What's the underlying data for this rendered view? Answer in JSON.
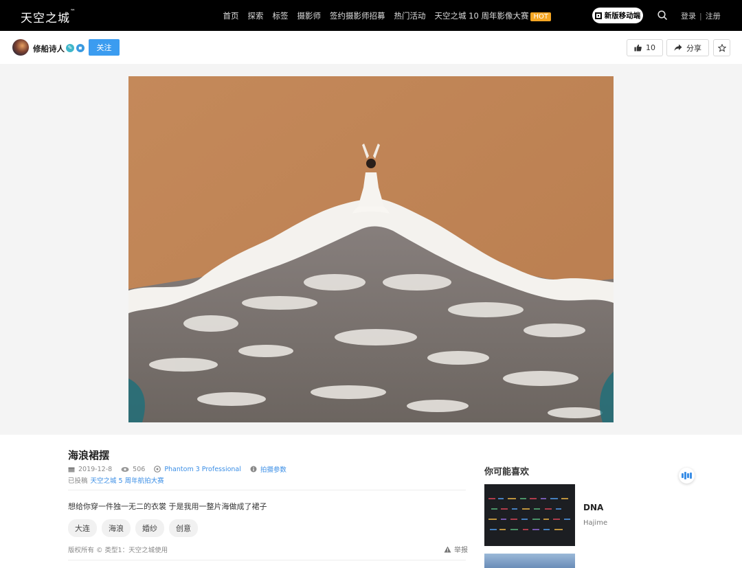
{
  "nav": {
    "logo": "天空之城",
    "logo_tm": "™",
    "links": [
      "首页",
      "探索",
      "标签",
      "摄影师",
      "签约摄影师招募",
      "热门活动",
      "天空之城 10 周年影像大赛"
    ],
    "hot_badge": "HOT",
    "mobile_button": "新版移动端",
    "login": "登录",
    "separator": "|",
    "register": "注册"
  },
  "author": {
    "name": "修船诗人",
    "follow_label": "关注",
    "like_count": "10",
    "share_label": "分享"
  },
  "photo": {
    "title": "海浪裙摆",
    "date": "2019-12-8",
    "views": "506",
    "camera": "Phantom 3 Professional",
    "params_label": "拍摄参数",
    "submitted_prefix": "已投稿",
    "contest": "天空之城 5 周年航拍大赛",
    "description": "想给你穿一件独一无二的衣裳 于是我用一整片海做成了裙子",
    "tags": [
      "大连",
      "海浪",
      "婚纱",
      "创意"
    ],
    "copyright": "版权所有 © 类型1：天空之城使用",
    "report_label": "举报"
  },
  "sidebar": {
    "title": "你可能喜欢",
    "items": [
      {
        "title": "DNA",
        "author": "Hajime"
      }
    ]
  },
  "colors": {
    "nav_bg": "#000000",
    "accent_blue": "#3b9cf0",
    "hot_orange": "#f5a623",
    "sand": "#c08a5a"
  }
}
